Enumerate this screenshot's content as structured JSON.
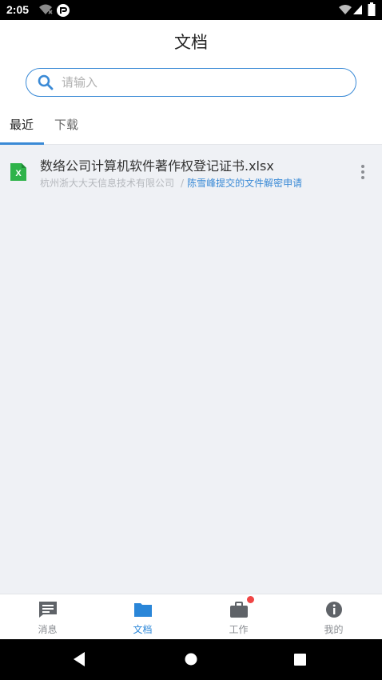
{
  "status_bar": {
    "time": "2:05"
  },
  "header": {
    "title": "文档"
  },
  "search": {
    "placeholder": "请输入"
  },
  "tabs": [
    {
      "label": "最近",
      "active": true
    },
    {
      "label": "下载",
      "active": false
    }
  ],
  "documents": [
    {
      "filename": "数络公司计算机软件著作权登记证书.xlsx",
      "file_icon": "excel-file-icon",
      "organization": "杭州浙大大天信息技术有限公司",
      "separator": "/",
      "source_link": "陈雪峰提交的文件解密申请"
    }
  ],
  "bottom_nav": [
    {
      "label": "消息",
      "icon": "message-icon",
      "active": false
    },
    {
      "label": "文档",
      "icon": "folder-icon",
      "active": true
    },
    {
      "label": "工作",
      "icon": "briefcase-icon",
      "active": false,
      "has_badge": true
    },
    {
      "label": "我的",
      "icon": "info-icon",
      "active": false
    }
  ],
  "colors": {
    "accent": "#3a8ad6",
    "badge": "#f04545",
    "excel_green": "#2fb34a"
  }
}
